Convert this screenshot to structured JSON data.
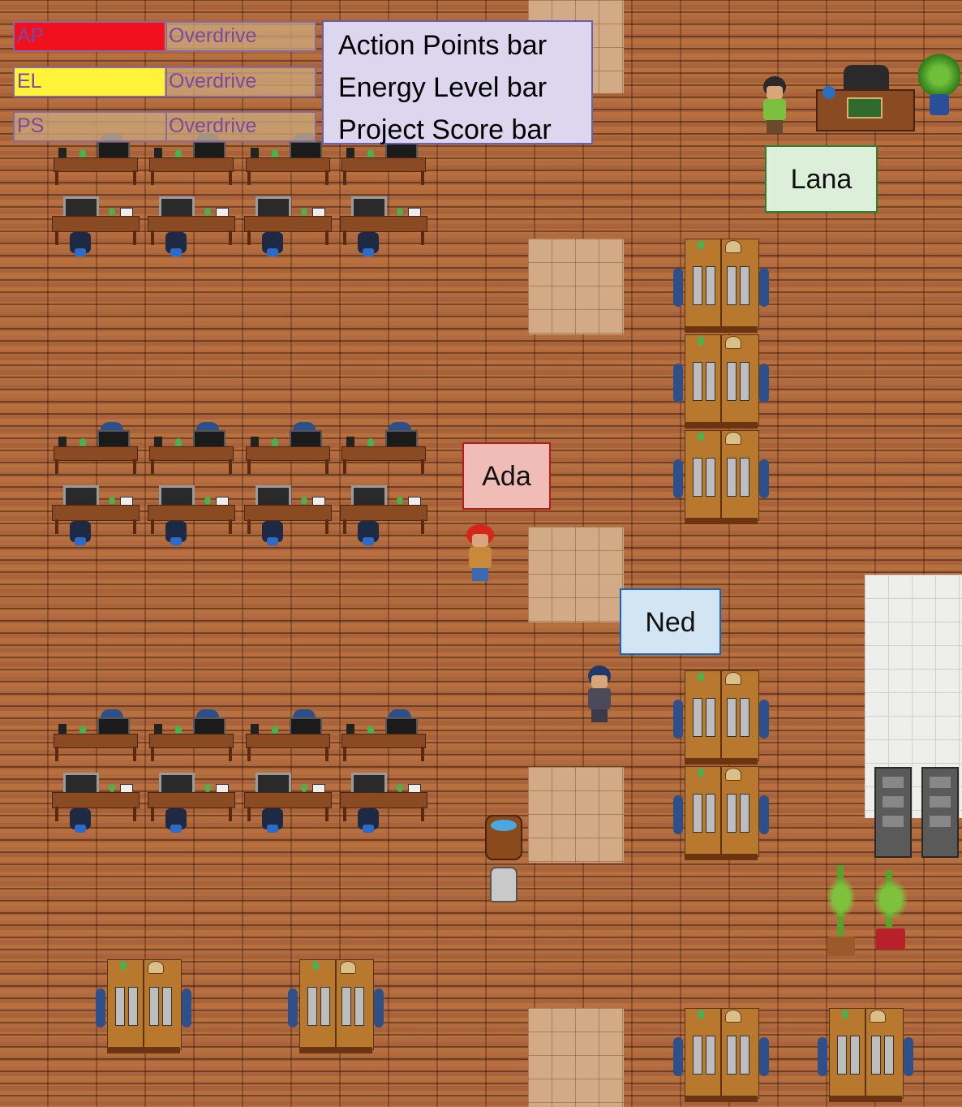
{
  "hud": {
    "bars": [
      {
        "label": "AP",
        "overdrive": "Overdrive",
        "fill_color": "#f0101e",
        "fill_fraction": 0.5
      },
      {
        "label": "EL",
        "overdrive": "Overdrive",
        "fill_color": "#fff33a",
        "fill_fraction": 0.5
      },
      {
        "label": "PS",
        "overdrive": "Overdrive",
        "fill_color": "#c7a77c",
        "fill_fraction": 0.0
      }
    ]
  },
  "legend": {
    "items": [
      "Action Points bar",
      "Energy Level bar",
      "Project Score bar"
    ]
  },
  "characters": {
    "lana": {
      "name": "Lana",
      "tag_color": "#dcefd8",
      "tag_border": "#2e7d32"
    },
    "ada": {
      "name": "Ada",
      "tag_color": "#efbcb6",
      "tag_border": "#b71c1c"
    },
    "ned": {
      "name": "Ned",
      "tag_color": "#d3e4f3",
      "tag_border": "#1565c0"
    }
  }
}
